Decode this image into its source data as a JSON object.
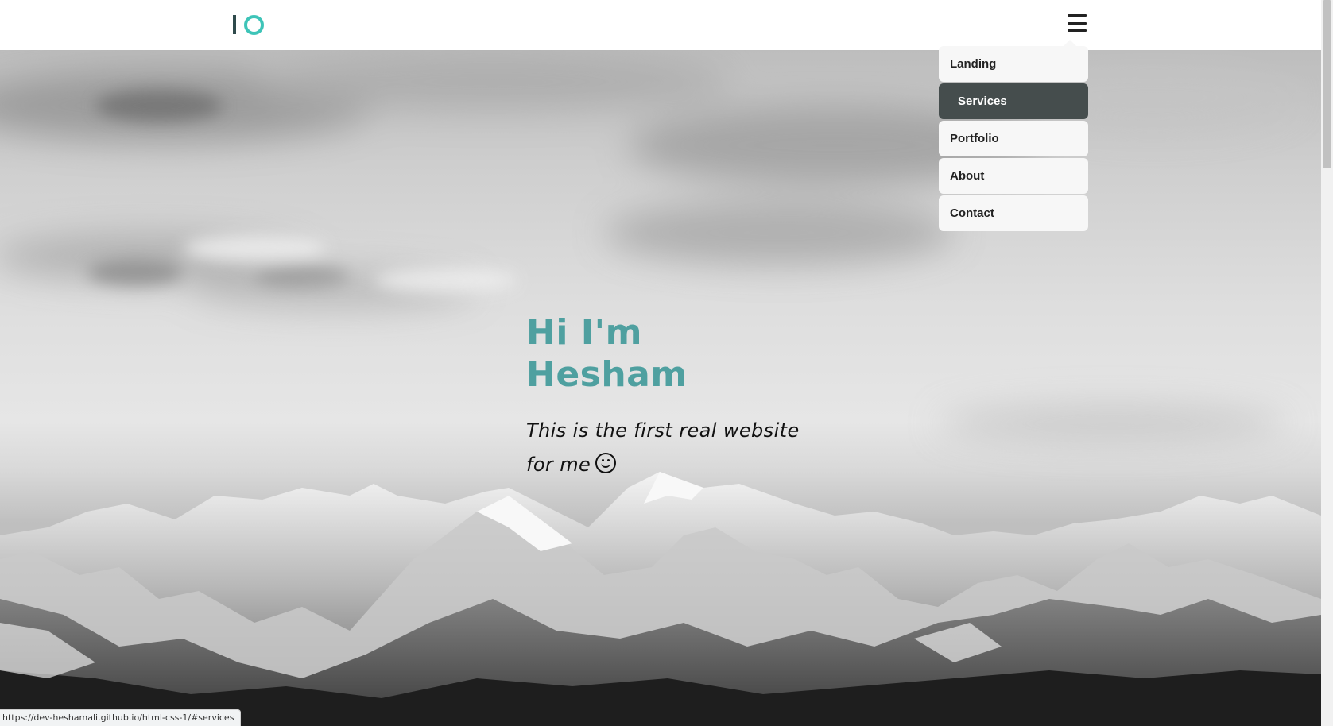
{
  "header": {
    "logo_label": "IO",
    "menu_icon": "hamburger-menu-icon"
  },
  "nav": {
    "items": [
      {
        "label": "Landing"
      },
      {
        "label": "Services",
        "active": true
      },
      {
        "label": "Portfolio"
      },
      {
        "label": "About"
      },
      {
        "label": "Contact"
      }
    ]
  },
  "hero": {
    "title": "Hi I'm Hesham",
    "subtitle": "This is the first real website for me",
    "emoji_icon": "smiley-icon"
  },
  "status_bar": {
    "url": "https://dev-heshamali.github.io/html-css-1/#services"
  },
  "colors": {
    "accent": "#4fa0a0",
    "logo_ring": "#3ec4b8",
    "menu_active_bg": "#454d4d"
  }
}
